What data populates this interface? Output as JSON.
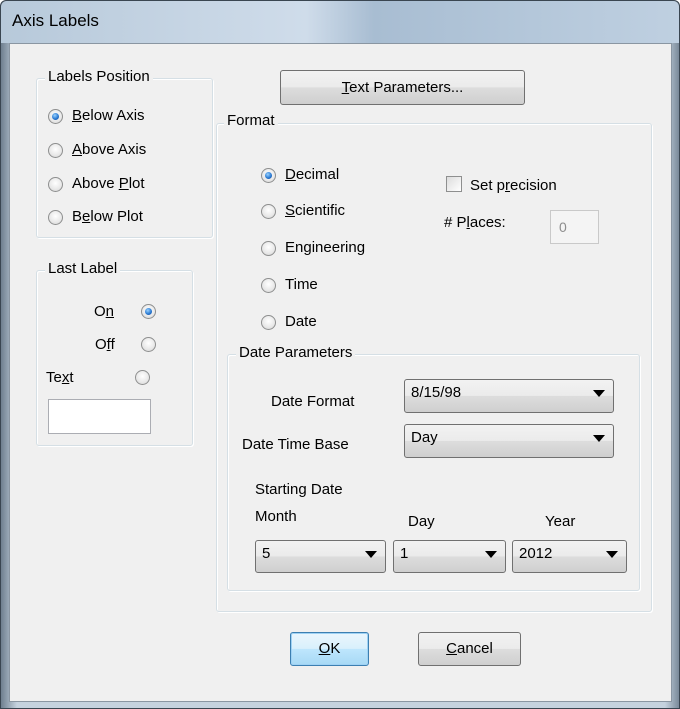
{
  "window": {
    "title": "Axis Labels"
  },
  "labels_position": {
    "legend": "Labels Position",
    "options": [
      {
        "pre": "",
        "key": "B",
        "post": "elow Axis",
        "checked": true
      },
      {
        "pre": "",
        "key": "A",
        "post": "bove Axis",
        "checked": false
      },
      {
        "pre": "Above ",
        "key": "P",
        "post": "lot",
        "checked": false
      },
      {
        "pre": "B",
        "key": "e",
        "post": "low Plot",
        "checked": false
      }
    ]
  },
  "last_label": {
    "legend": "Last Label",
    "on": {
      "pre": "O",
      "key": "n",
      "post": "",
      "checked": true
    },
    "off": {
      "pre": "O",
      "key": "f",
      "post": "f",
      "checked": false
    },
    "text": {
      "pre": "Te",
      "key": "x",
      "post": "t",
      "checked": false
    },
    "text_value": ""
  },
  "text_parameters_button": {
    "pre": "",
    "key": "T",
    "post": "ext Parameters..."
  },
  "format": {
    "legend": "Format",
    "options": [
      {
        "pre": "",
        "key": "D",
        "post": "ecimal",
        "checked": true
      },
      {
        "pre": "",
        "key": "S",
        "post": "cientific",
        "checked": false
      },
      {
        "pre": "En",
        "key": "g",
        "post": "ineering",
        "checked": false
      },
      {
        "pre": "Time",
        "key": "",
        "post": "",
        "checked": false
      },
      {
        "pre": "Date",
        "key": "",
        "post": "",
        "checked": false
      }
    ],
    "set_precision": {
      "pre": "Set p",
      "key": "r",
      "post": "ecision",
      "checked": false
    },
    "places": {
      "pre": "# P",
      "key": "l",
      "post": "aces:",
      "value": "0"
    }
  },
  "date_parameters": {
    "legend": "Date Parameters",
    "date_format_label": "Date Format",
    "date_format_value": "8/15/98",
    "date_time_base_label": "Date Time Base",
    "date_time_base_value": "Day",
    "starting_date_label": "Starting Date",
    "month_label": "Month",
    "day_label": "Day",
    "year_label": "Year",
    "month_value": "5",
    "day_value": "1",
    "year_value": "2012"
  },
  "buttons": {
    "ok": {
      "pre": "",
      "key": "O",
      "post": "K"
    },
    "cancel": {
      "pre": "",
      "key": "C",
      "post": "ancel"
    }
  },
  "colors": {
    "accent": "#2b7bd3",
    "default_button_border": "#3c7fb1"
  }
}
